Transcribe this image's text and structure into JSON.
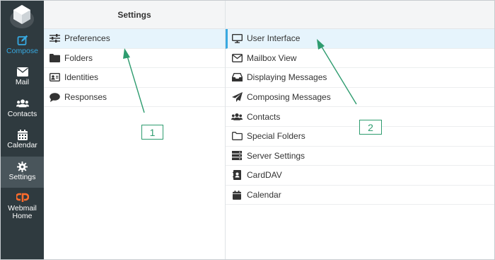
{
  "nav": {
    "items": [
      {
        "label": "Compose",
        "icon": "compose-icon"
      },
      {
        "label": "Mail",
        "icon": "mail-icon"
      },
      {
        "label": "Contacts",
        "icon": "contacts-icon"
      },
      {
        "label": "Calendar",
        "icon": "calendar-icon"
      },
      {
        "label": "Settings",
        "icon": "gear-icon"
      },
      {
        "label": "Webmail Home",
        "icon": "cpanel-icon"
      }
    ],
    "active": "Settings"
  },
  "settings": {
    "title": "Settings",
    "items": [
      {
        "label": "Preferences",
        "icon": "sliders-icon",
        "selected": true
      },
      {
        "label": "Folders",
        "icon": "folder-icon"
      },
      {
        "label": "Identities",
        "icon": "id-card-icon"
      },
      {
        "label": "Responses",
        "icon": "comment-icon"
      }
    ]
  },
  "preferences": {
    "items": [
      {
        "label": "User Interface",
        "icon": "monitor-icon",
        "selected": true
      },
      {
        "label": "Mailbox View",
        "icon": "envelope-outline-icon"
      },
      {
        "label": "Displaying Messages",
        "icon": "inbox-icon"
      },
      {
        "label": "Composing Messages",
        "icon": "paper-plane-icon"
      },
      {
        "label": "Contacts",
        "icon": "users-icon"
      },
      {
        "label": "Special Folders",
        "icon": "folder-outline-icon"
      },
      {
        "label": "Server Settings",
        "icon": "server-icon"
      },
      {
        "label": "CardDAV",
        "icon": "address-book-icon"
      },
      {
        "label": "Calendar",
        "icon": "calendar-icon"
      }
    ]
  },
  "annotations": {
    "label1": "1",
    "label2": "2",
    "color": "#2e9c6f"
  },
  "colors": {
    "rail_bg": "#2f3a3f",
    "accent": "#37a9e1",
    "selected_bg": "#e6f4fc"
  }
}
